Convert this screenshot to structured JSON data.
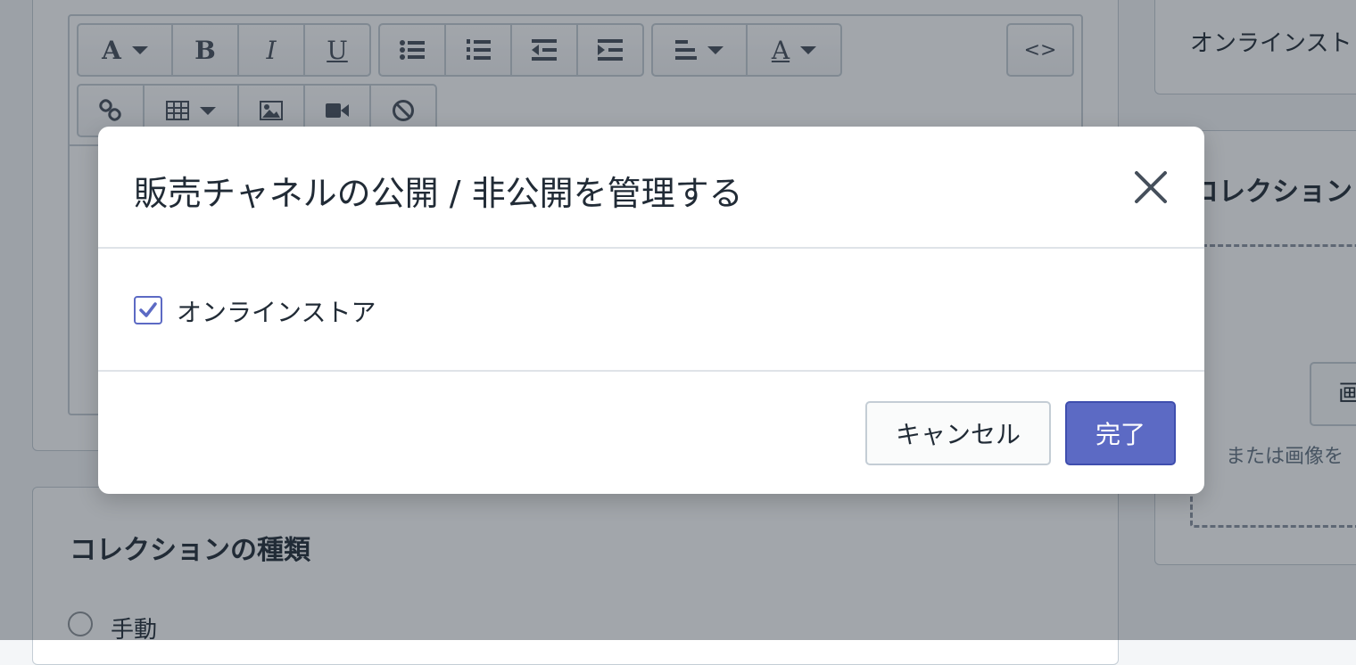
{
  "editor": {
    "toolbar_row1": [
      {
        "name": "font-style-button",
        "glyph": "A",
        "caret": true
      },
      {
        "name": "bold-button",
        "glyph": "B"
      },
      {
        "name": "italic-button",
        "glyph": "I"
      },
      {
        "name": "underline-button",
        "glyph": "U"
      },
      {
        "name": "bulleted-list-button",
        "glyph": "☰"
      },
      {
        "name": "numbered-list-button",
        "glyph": "☰"
      },
      {
        "name": "outdent-button",
        "glyph": "⇤"
      },
      {
        "name": "indent-button",
        "glyph": "⇥"
      },
      {
        "name": "align-button",
        "glyph": "≡",
        "caret": true
      },
      {
        "name": "text-color-button",
        "glyph": "A",
        "caret": true
      }
    ],
    "html_button": "<>",
    "toolbar_row2": [
      "link-icon",
      "table-icon",
      "image-icon",
      "video-icon",
      "clear-format-icon"
    ]
  },
  "right_panel": {
    "channel_text": "オンラインスト",
    "image_title": "コレクション",
    "add_image_button": "画",
    "drop_hint": "または画像を"
  },
  "collection_type": {
    "title": "コレクションの種類",
    "option_manual": "手動"
  },
  "modal": {
    "title": "販売チャネルの公開 / 非公開を管理する",
    "channel_label": "オンラインストア",
    "channel_checked": true,
    "cancel_label": "キャンセル",
    "done_label": "完了"
  },
  "colors": {
    "primary": "#5c6ac4",
    "overlay": "rgba(33,43,54,0.42)",
    "border": "#c4cdd5"
  }
}
